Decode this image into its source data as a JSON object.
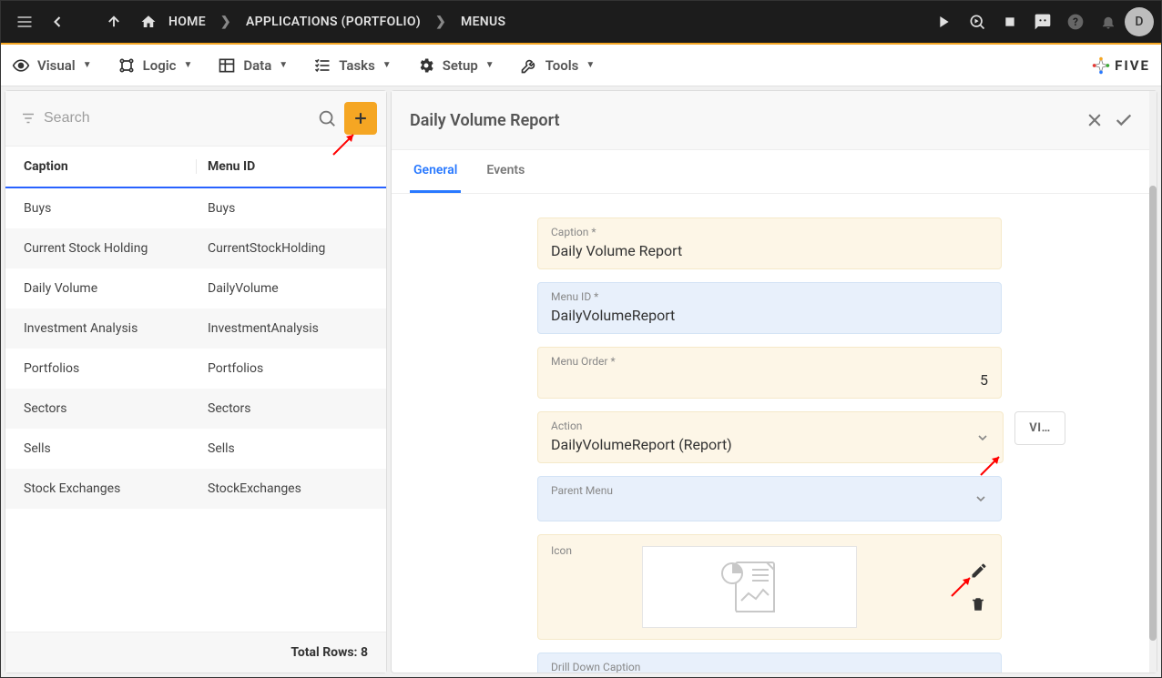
{
  "topbar": {
    "home_label": "HOME",
    "crumb2": "APPLICATIONS (PORTFOLIO)",
    "crumb3": "MENUS",
    "avatar": "D"
  },
  "menubar": {
    "visual": "Visual",
    "logic": "Logic",
    "data": "Data",
    "tasks": "Tasks",
    "setup": "Setup",
    "tools": "Tools",
    "brand": "FIVE"
  },
  "search": {
    "placeholder": "Search"
  },
  "table": {
    "col1": "Caption",
    "col2": "Menu ID",
    "rows": [
      {
        "caption": "Buys",
        "menuId": "Buys"
      },
      {
        "caption": "Current Stock Holding",
        "menuId": "CurrentStockHolding"
      },
      {
        "caption": "Daily Volume",
        "menuId": "DailyVolume"
      },
      {
        "caption": "Investment Analysis",
        "menuId": "InvestmentAnalysis"
      },
      {
        "caption": "Portfolios",
        "menuId": "Portfolios"
      },
      {
        "caption": "Sectors",
        "menuId": "Sectors"
      },
      {
        "caption": "Sells",
        "menuId": "Sells"
      },
      {
        "caption": "Stock Exchanges",
        "menuId": "StockExchanges"
      }
    ],
    "footer": "Total Rows: 8"
  },
  "detail": {
    "title": "Daily Volume Report",
    "tabs": {
      "general": "General",
      "events": "Events"
    },
    "fields": {
      "caption_label": "Caption *",
      "caption_value": "Daily Volume Report",
      "menuid_label": "Menu ID *",
      "menuid_value": "DailyVolumeReport",
      "menuorder_label": "Menu Order *",
      "menuorder_value": "5",
      "action_label": "Action",
      "action_value": "DailyVolumeReport (Report)",
      "parent_label": "Parent Menu",
      "parent_value": "",
      "icon_label": "Icon",
      "drill_label": "Drill Down Caption",
      "vi_label": "VI…"
    }
  }
}
